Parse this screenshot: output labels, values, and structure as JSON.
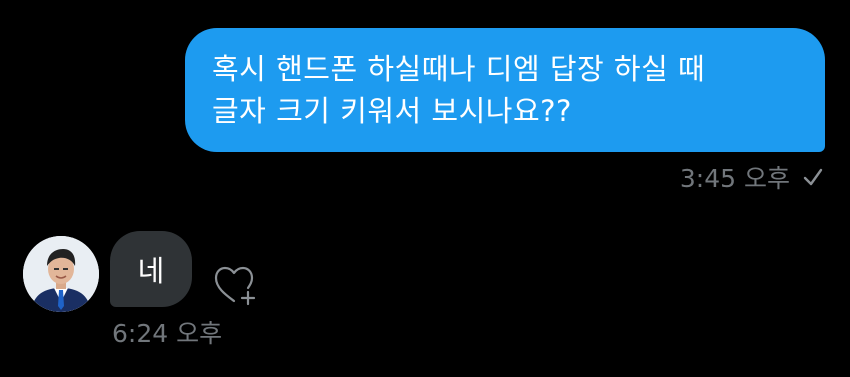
{
  "conversation": {
    "outgoing": {
      "lines": [
        "혹시 핸드폰 하실때나 디엠 답장 하실 때",
        "글자 크기 키워서 보시나요??"
      ],
      "timestamp": "3:45 오후",
      "status_icon": "check-icon"
    },
    "incoming": {
      "avatar_icon": "avatar",
      "text": "네",
      "timestamp": "6:24 오후",
      "reaction_icon": "heart-add-icon"
    }
  },
  "colors": {
    "background": "#000000",
    "outgoing_bubble": "#1d9bf0",
    "incoming_bubble": "#2f3336",
    "meta_text": "#71767b"
  }
}
